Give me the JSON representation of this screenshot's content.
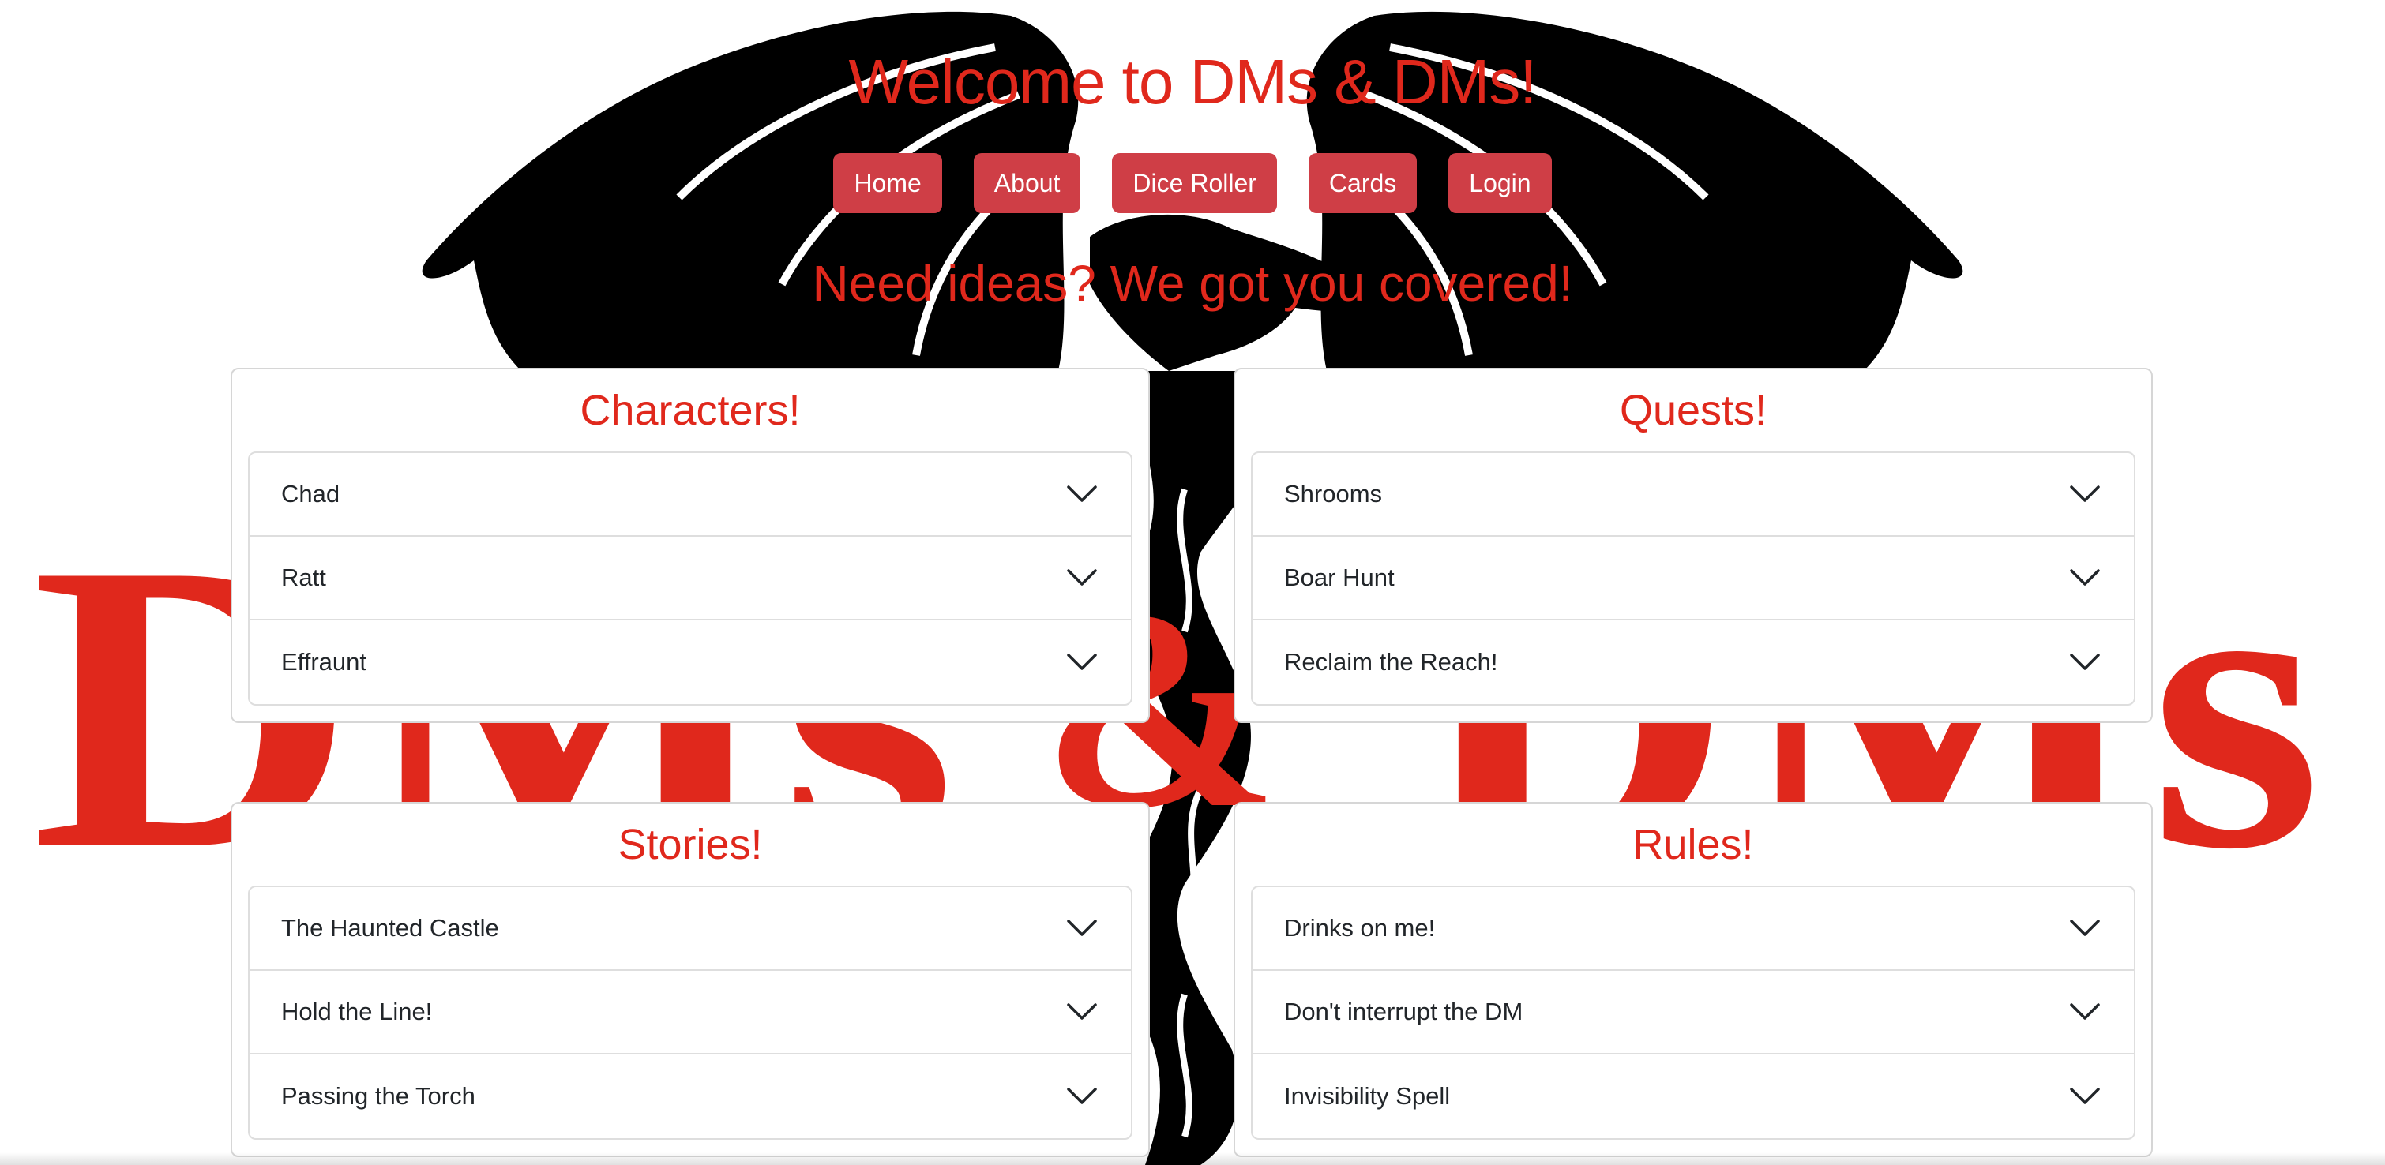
{
  "header": {
    "title": "Welcome to DMs & DMs!",
    "tagline": "Need ideas? We got you covered!"
  },
  "nav": {
    "items": [
      {
        "label": "Home"
      },
      {
        "label": "About"
      },
      {
        "label": "Dice Roller"
      },
      {
        "label": "Cards"
      },
      {
        "label": "Login"
      }
    ]
  },
  "background": {
    "logo_text": "DMs & DMs",
    "dragon": "dragon-silhouette"
  },
  "cards": {
    "characters": {
      "title": "Characters!",
      "items": [
        {
          "label": "Chad"
        },
        {
          "label": "Ratt"
        },
        {
          "label": "Effraunt"
        }
      ]
    },
    "quests": {
      "title": "Quests!",
      "items": [
        {
          "label": "Shrooms"
        },
        {
          "label": "Boar Hunt"
        },
        {
          "label": "Reclaim the Reach!"
        }
      ]
    },
    "stories": {
      "title": "Stories!",
      "items": [
        {
          "label": "The Haunted Castle"
        },
        {
          "label": "Hold the Line!"
        },
        {
          "label": "Passing the Torch"
        }
      ]
    },
    "rules": {
      "title": "Rules!",
      "items": [
        {
          "label": "Drinks on me!"
        },
        {
          "label": "Don't interrupt the DM"
        },
        {
          "label": "Invisibility Spell"
        }
      ]
    }
  },
  "colors": {
    "brand_red": "#e0281c",
    "button_red": "#cf3e46",
    "dragon_black": "#000000"
  }
}
